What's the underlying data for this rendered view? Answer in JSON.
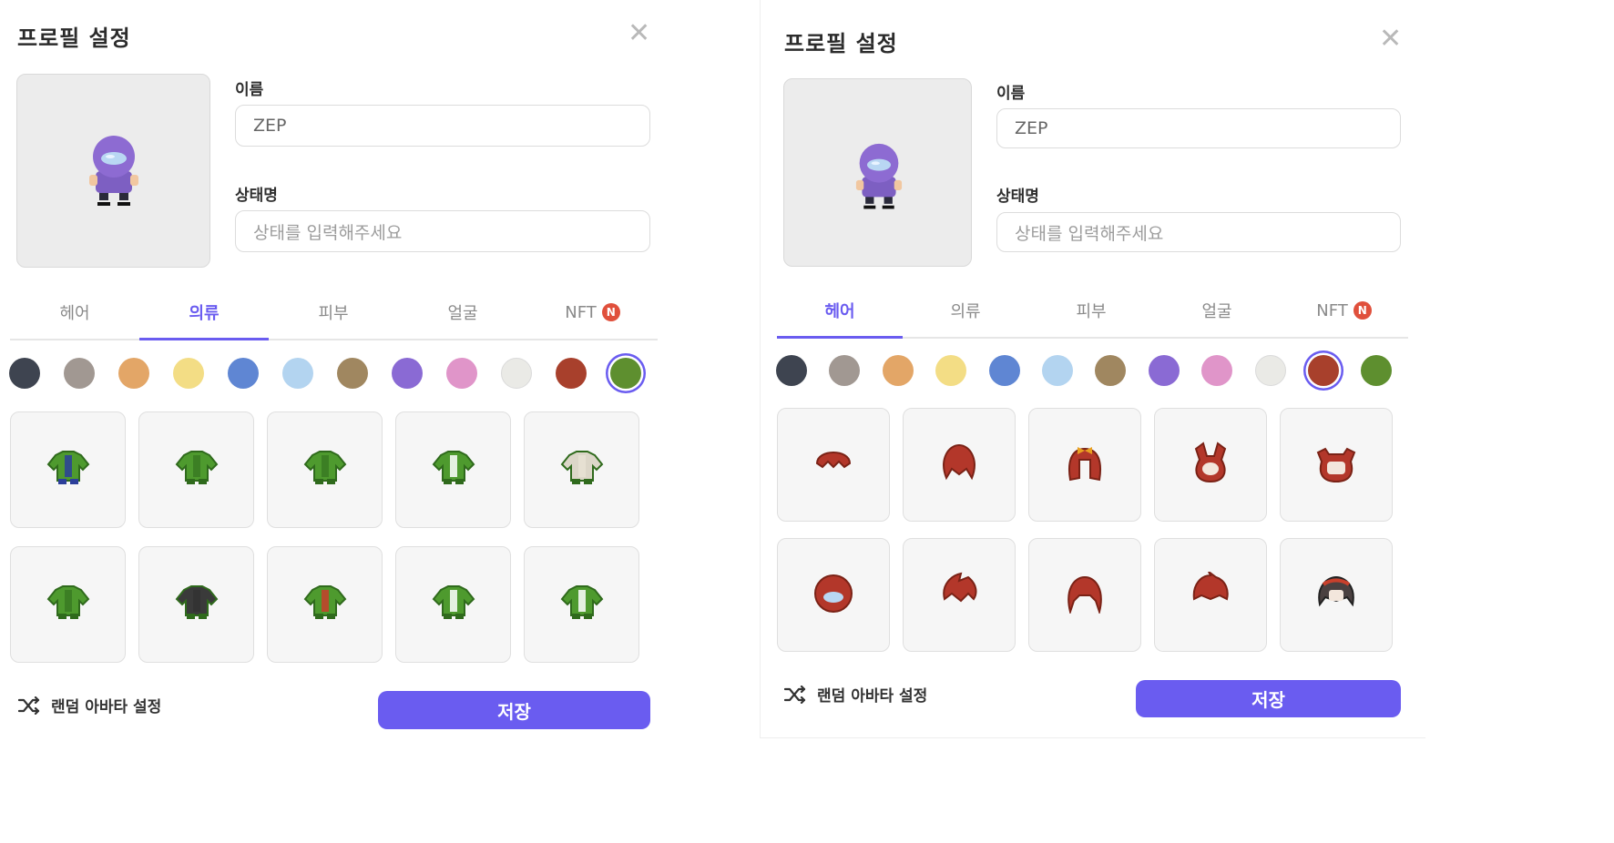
{
  "left": {
    "title": "프로필 설정",
    "close": "✕",
    "name_label": "이름",
    "name_value": "ZEP",
    "status_label": "상태명",
    "status_placeholder": "상태를 입력해주세요",
    "tabs": [
      {
        "label": "헤어",
        "active": false
      },
      {
        "label": "의류",
        "active": true
      },
      {
        "label": "피부",
        "active": false
      },
      {
        "label": "얼굴",
        "active": false
      },
      {
        "label": "NFT",
        "active": false,
        "badge": "N"
      }
    ],
    "selected_color": "#5e8f2f",
    "item_category": "clothing",
    "random_label": "랜덤 아바타 설정",
    "save_label": "저장"
  },
  "right": {
    "title": "프로필 설정",
    "close": "✕",
    "name_label": "이름",
    "name_value": "ZEP",
    "status_label": "상태명",
    "status_placeholder": "상태를 입력해주세요",
    "tabs": [
      {
        "label": "헤어",
        "active": true
      },
      {
        "label": "의류",
        "active": false
      },
      {
        "label": "피부",
        "active": false
      },
      {
        "label": "얼굴",
        "active": false
      },
      {
        "label": "NFT",
        "active": false,
        "badge": "N"
      }
    ],
    "selected_color": "#a8402c",
    "item_category": "hair",
    "random_label": "랜덤 아바타 설정",
    "save_label": "저장"
  },
  "colors": [
    "#3e4450",
    "#a19892",
    "#e3a667",
    "#f3dd85",
    "#5f86d3",
    "#b3d4f0",
    "#a08760",
    "#8a6ad4",
    "#e095c9",
    "#eaeae6",
    "#a8402c",
    "#5e8f2f"
  ],
  "accent": "#6a5cf0"
}
